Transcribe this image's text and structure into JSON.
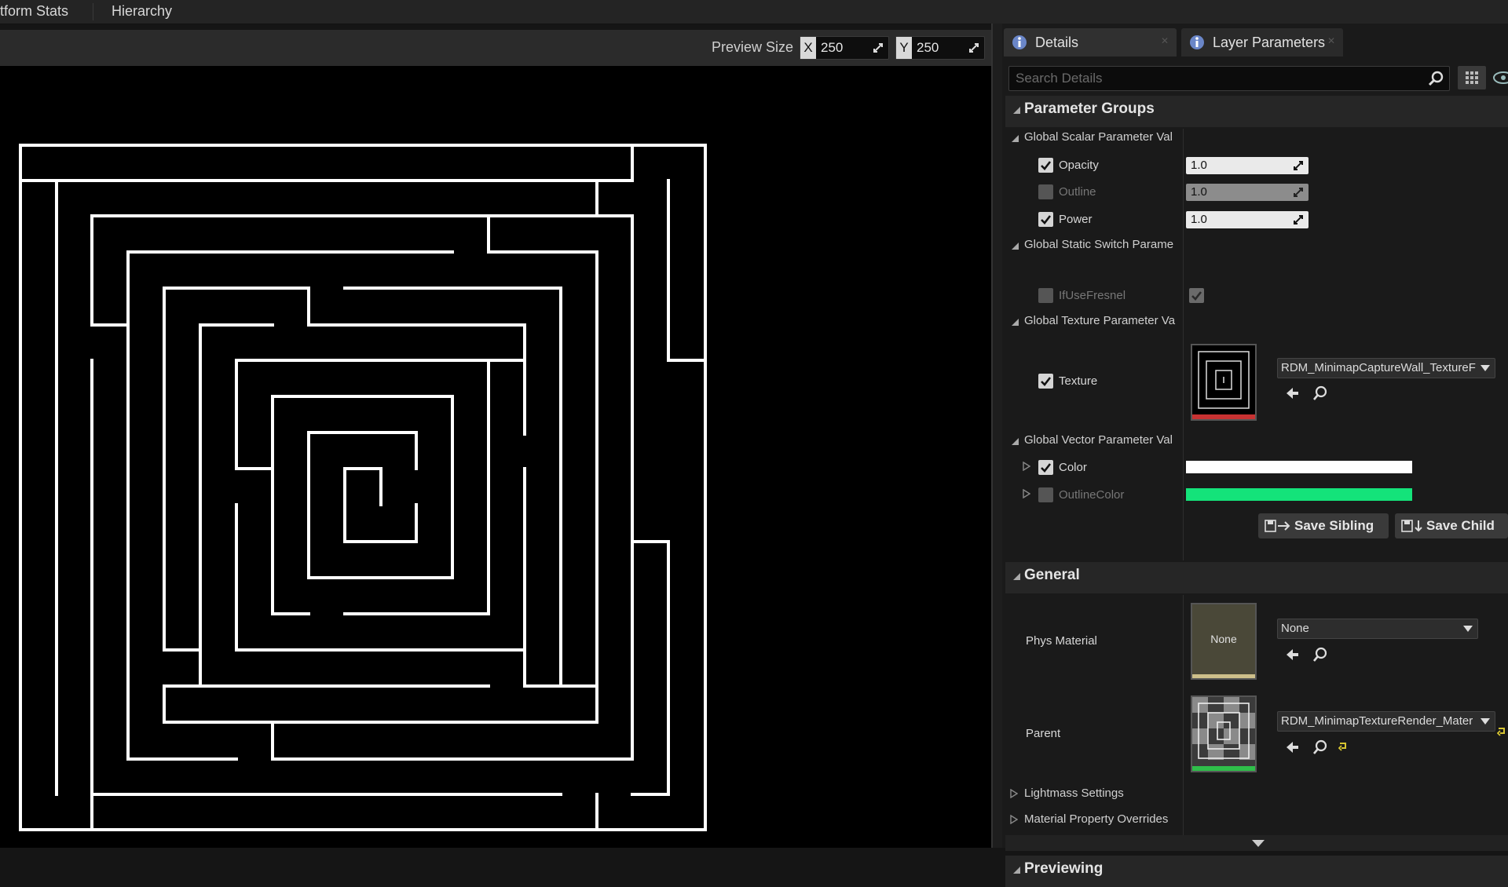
{
  "top_tabs": [
    "tform Stats",
    "Hierarchy"
  ],
  "preview": {
    "size_label": "Preview Size",
    "x_axis": "X",
    "x_value": "250",
    "y_axis": "Y",
    "y_value": "250",
    "maze_color": "#ffffff"
  },
  "details_tabs": {
    "details": "Details",
    "layer_parameters": "Layer Parameters"
  },
  "search": {
    "placeholder": "Search Details"
  },
  "parameter_groups": {
    "title": "Parameter Groups",
    "global_scalar": "Global Scalar Parameter Val",
    "opacity_label": "Opacity",
    "opacity_value": "1.0",
    "outline_label": "Outline",
    "outline_value": "1.0",
    "power_label": "Power",
    "power_value": "1.0",
    "global_static_switch": "Global Static Switch Parame",
    "ifusefresnel_label": "IfUseFresnel",
    "global_texture": "Global Texture Parameter Va",
    "texture_label": "Texture",
    "texture_asset": "RDM_MinimapCaptureWall_TextureF",
    "global_vector": "Global Vector Parameter Val",
    "color_label": "Color",
    "color_value": "#ffffff",
    "outlinecolor_label": "OutlineColor",
    "outlinecolor_value": "#14e37a",
    "save_sibling": "Save Sibling",
    "save_child": "Save Child"
  },
  "general": {
    "title": "General",
    "phys_material_label": "Phys Material",
    "phys_material_thumb": "None",
    "phys_material_value": "None",
    "parent_label": "Parent",
    "parent_value": "RDM_MinimapTextureRender_Mater",
    "lightmass": "Lightmass Settings",
    "material_property_overrides": "Material Property Overrides"
  },
  "previewing": {
    "title": "Previewing"
  }
}
